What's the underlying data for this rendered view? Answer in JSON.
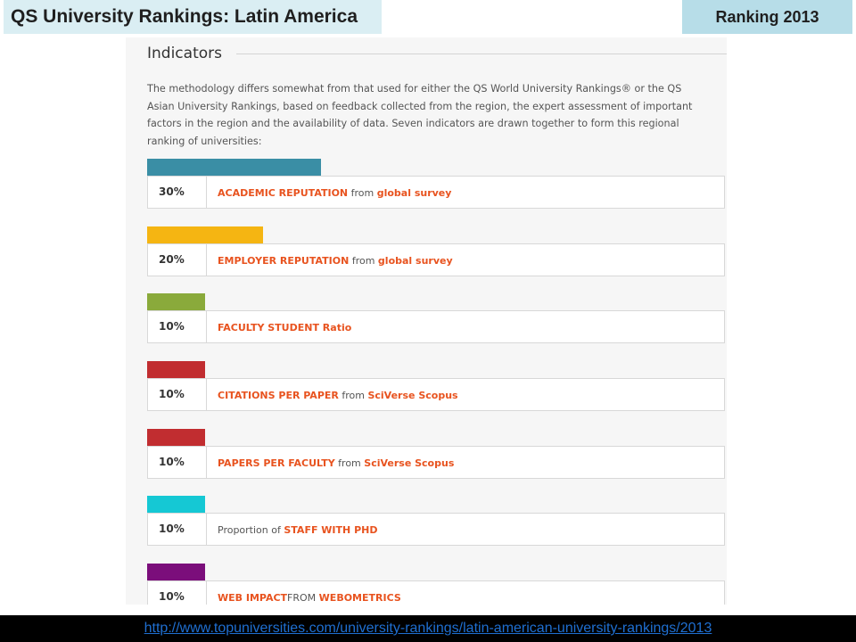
{
  "header": {
    "title": "QS University Rankings: Latin America",
    "ranking_label": "Ranking 2013"
  },
  "section": {
    "heading": "Indicators",
    "intro": "The methodology differs somewhat from that used for either the QS World University Rankings® or the QS Asian University Rankings, based on feedback collected from the region, the expert assessment of important factors in the region and the availability of data. Seven indicators are drawn together to form this regional ranking of universities:"
  },
  "indicators": [
    {
      "percent": "30%",
      "weight": 0.3,
      "color": "#3a8ea5",
      "prefix": "",
      "highlight": "ACADEMIC REPUTATION",
      "middle": " from ",
      "source": "global survey"
    },
    {
      "percent": "20%",
      "weight": 0.2,
      "color": "#f5b512",
      "prefix": "",
      "highlight": "EMPLOYER REPUTATION",
      "middle": " from ",
      "source": "global survey"
    },
    {
      "percent": "10%",
      "weight": 0.1,
      "color": "#8aaa3b",
      "prefix": "",
      "highlight": "FACULTY STUDENT Ratio",
      "middle": "",
      "source": ""
    },
    {
      "percent": "10%",
      "weight": 0.1,
      "color": "#c12d30",
      "prefix": "",
      "highlight": "CITATIONS PER PAPER",
      "middle": " from ",
      "source": "SciVerse Scopus"
    },
    {
      "percent": "10%",
      "weight": 0.1,
      "color": "#c12d30",
      "prefix": "",
      "highlight": "PAPERS PER FACULTY",
      "middle": " from ",
      "source": "SciVerse Scopus"
    },
    {
      "percent": "10%",
      "weight": 0.1,
      "color": "#15c8d4",
      "prefix": "Proportion of ",
      "highlight": "STAFF WITH PHD",
      "middle": "",
      "source": ""
    },
    {
      "percent": "10%",
      "weight": 0.1,
      "color": "#7b0e7b",
      "prefix": "",
      "highlight": "WEB IMPACT",
      "middle": "FROM ",
      "source": "WEBOMETRICS"
    }
  ],
  "footer": {
    "link": "http://www.topuniversities.com/university-rankings/latin-american-university-rankings/2013"
  }
}
